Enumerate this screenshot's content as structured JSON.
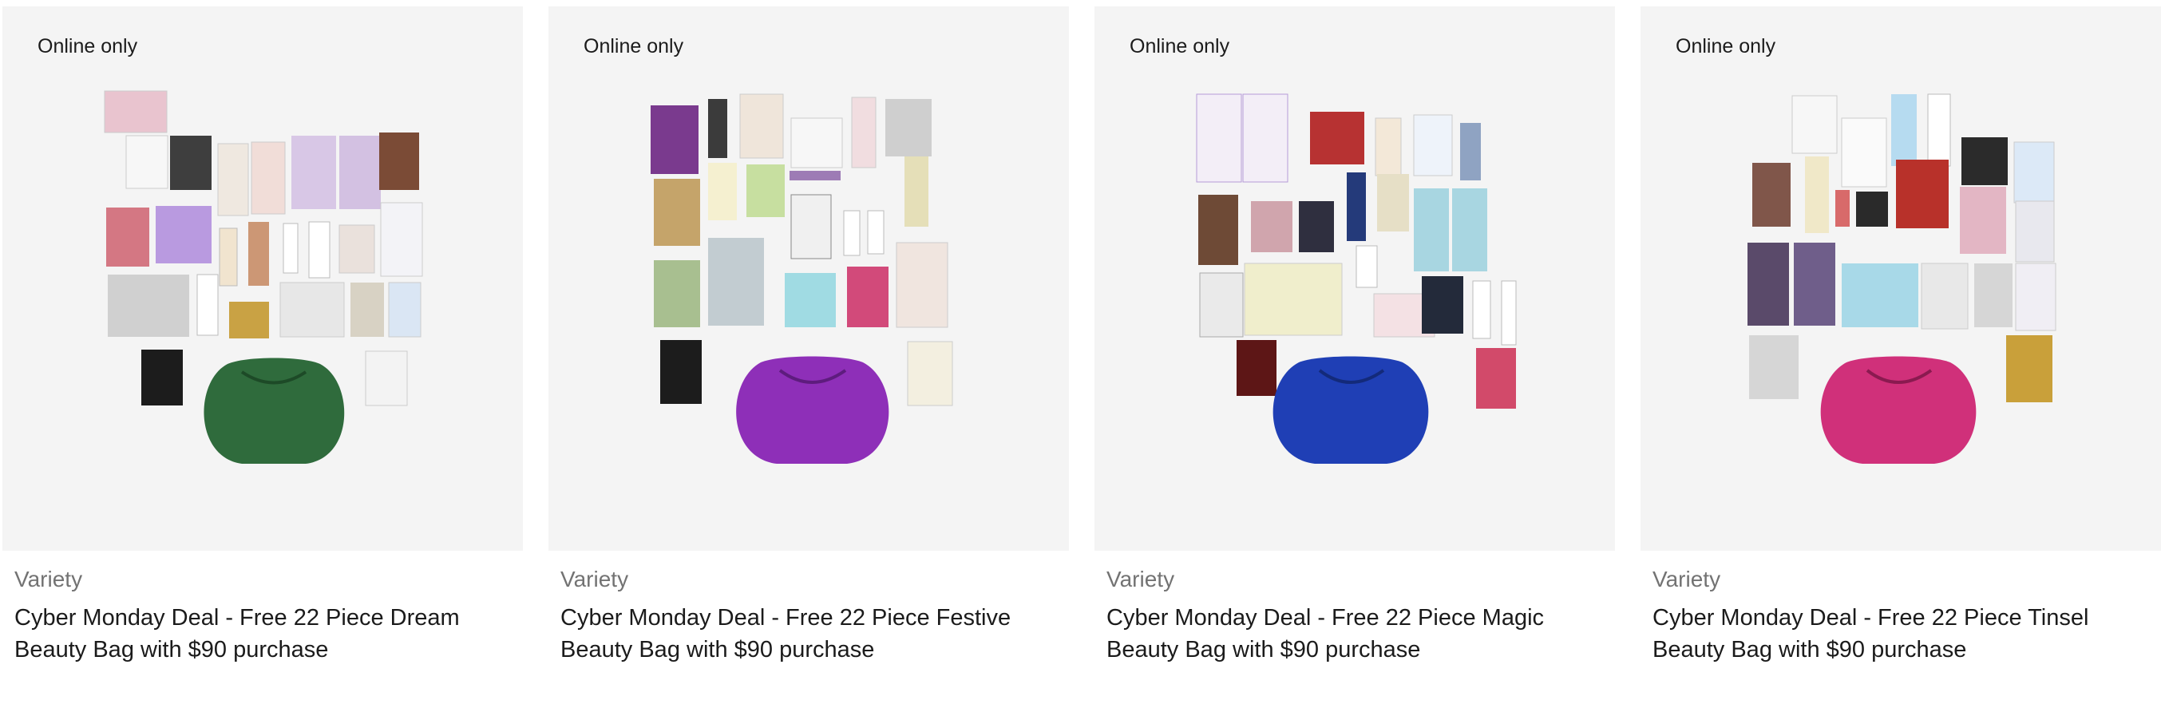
{
  "products": [
    {
      "badge": "Online only",
      "brand": "Variety",
      "title": "Cyber Monday Deal - Free 22 Piece Dream Beauty Bag with $90 purchase",
      "bag_color": "#2f6b3c",
      "image_icon": "beauty-bag-image"
    },
    {
      "badge": "Online only",
      "brand": "Variety",
      "title": "Cyber Monday Deal - Free 22 Piece Festive Beauty Bag with $90 purchase",
      "bag_color": "#8e2fb8",
      "image_icon": "beauty-bag-image"
    },
    {
      "badge": "Online only",
      "brand": "Variety",
      "title": "Cyber Monday Deal - Free 22 Piece Magic Beauty Bag with $90 purchase",
      "bag_color": "#1f3fb5",
      "image_icon": "beauty-bag-image"
    },
    {
      "badge": "Online only",
      "brand": "Variety",
      "title": "Cyber Monday Deal - Free 22 Piece Tinsel Beauty Bag with $90 purchase",
      "bag_color": "#d0307a",
      "image_icon": "beauty-bag-image"
    }
  ]
}
